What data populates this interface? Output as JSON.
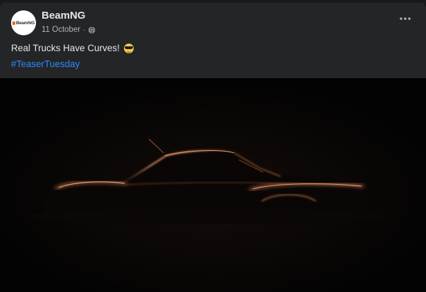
{
  "post": {
    "page_name": "BeamNG",
    "avatar_text": "BeamNG",
    "date": "11 October",
    "separator": "·",
    "privacy_icon": "globe-icon",
    "more_icon": "more-options-icon",
    "caption": "Real Trucks Have Curves!",
    "caption_emoji": "smiling-face-with-sunglasses",
    "hashtag": "#TeaserTuesday",
    "image_description_icon": "car-silhouette-image"
  },
  "colors": {
    "post_background": "#242526",
    "page_background": "#18191a",
    "primary_text": "#e4e6eb",
    "secondary_text": "#b0b3b8",
    "link": "#2d88ff",
    "highlight_copper": "#c8744a",
    "brand_orange": "#e8651d"
  }
}
